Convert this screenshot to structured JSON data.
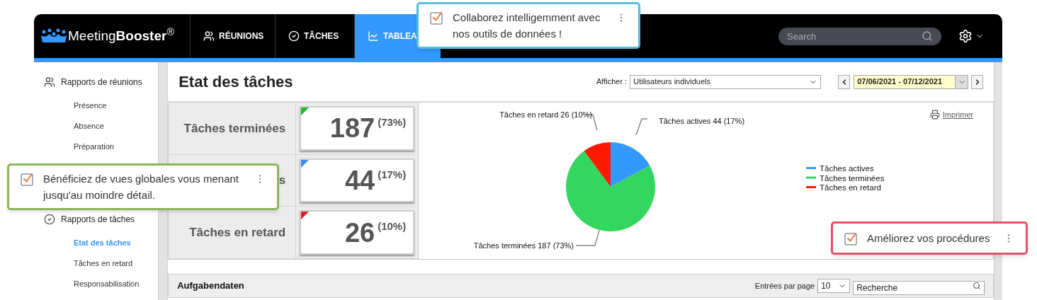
{
  "header": {
    "logo": "Meeting**Booster**$^{®}$",
    "tabs": [
      {
        "label": "RÉUNIONS",
        "selected": false
      },
      {
        "label": "TÂCHES",
        "selected": false
      },
      {
        "label": "TABLEA",
        "selected": true
      }
    ],
    "search": {
      "placeholder": "Search"
    }
  },
  "sidebar": {
    "sections": [
      {
        "title": "Rapports de réunions",
        "items": [
          {
            "label": "Présence",
            "selected": false
          },
          {
            "label": "Absence",
            "selected": false
          },
          {
            "label": "Préparation",
            "selected": false
          }
        ]
      },
      {
        "title": "Rapports de tâches",
        "items": [
          {
            "label": "Etat des tâches",
            "selected": true
          },
          {
            "label": "Tâches en retard",
            "selected": false
          },
          {
            "label": "Responsabilisation",
            "selected": false
          }
        ]
      }
    ]
  },
  "main": {
    "title": "Etat des tâches",
    "filter": {
      "label": "Afficher :",
      "value": "Utilisateurs individuels"
    },
    "date_range": "07/06/2021 - 07/12/2021",
    "stats": [
      {
        "label": "Tâches terminées",
        "value": "187",
        "percent": "(73%)",
        "color": "#22b422"
      },
      {
        "label": "s",
        "value": "44",
        "percent": "(17%)",
        "color": "#3a8ee6"
      },
      {
        "label": "Tâches en retard",
        "value": "26",
        "percent": "(10%)",
        "color": "#e02020"
      }
    ],
    "print_link": "Imprimer",
    "chart_data": {
      "type": "pie",
      "categories": [
        "Tâches actives",
        "Tâches terminées",
        "Tâches en retard"
      ],
      "values": [
        44,
        187,
        26
      ],
      "colors": [
        "#3399ff",
        "#33d65e",
        "#ff1a00"
      ],
      "value_labels": [
        "Tâches actives 44 (17%)",
        "Tâches terminées 187 (73%)",
        "Tâches en retard 26 (10%)"
      ],
      "legend": "right"
    },
    "table": {
      "title": "Aufgabendaten",
      "page_size_label": "Entrées par page",
      "page_size": "10",
      "search_placeholder": "Recherche"
    }
  },
  "callouts": [
    {
      "text": "Collaborez intelligemment avec nos outils de données !",
      "color": "#55bde0"
    },
    {
      "text": "Bénéficiez de vues globales vous menant jusqu'au moindre détail.",
      "color": "#8bb75a"
    },
    {
      "text": "Améliorez vos procédures",
      "color": "#e0546a"
    }
  ]
}
